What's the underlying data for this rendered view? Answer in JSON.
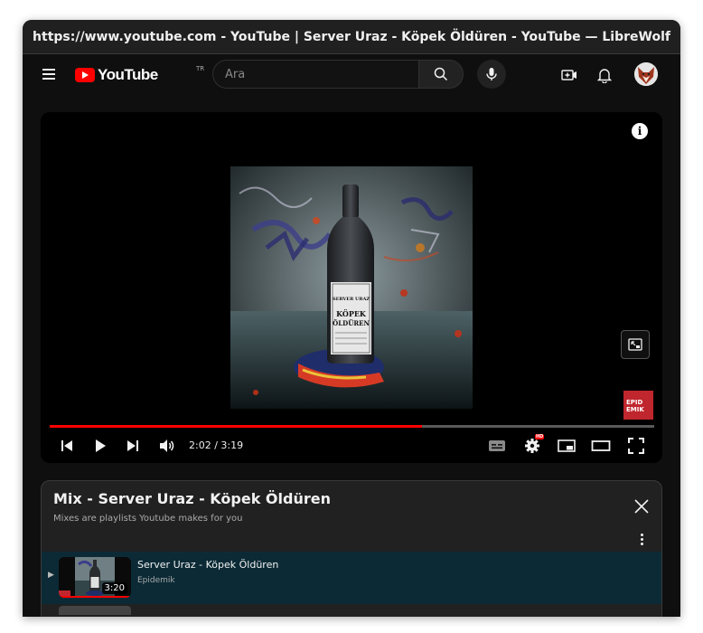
{
  "window": {
    "title": "https://www.youtube.com - YouTube | Server Uraz - Köpek Öldüren - YouTube — LibreWolf"
  },
  "header": {
    "logo_text": "YouTube",
    "country_code": "TR",
    "search_placeholder": "Ara"
  },
  "player": {
    "artwork_label": "SERVER URAZ",
    "artwork_title_1": "KÖPEK",
    "artwork_title_2": "ÖLDÜREN",
    "watermark_1": "EPID",
    "watermark_2": "EMIK",
    "progress_fraction": 0.616,
    "time": "2:02 / 3:19",
    "hd_badge": "HD"
  },
  "playlist": {
    "title": "Mix - Server Uraz - Köpek Öldüren",
    "subtitle": "Mixes are playlists Youtube makes for you",
    "items": [
      {
        "title": "Server Uraz - Köpek Öldüren",
        "channel": "Epidemik",
        "duration": "3:20"
      }
    ]
  },
  "colors": {
    "brand_red": "#ff0000",
    "background": "#0f0f0f",
    "selected_item": "#0b2a36"
  }
}
